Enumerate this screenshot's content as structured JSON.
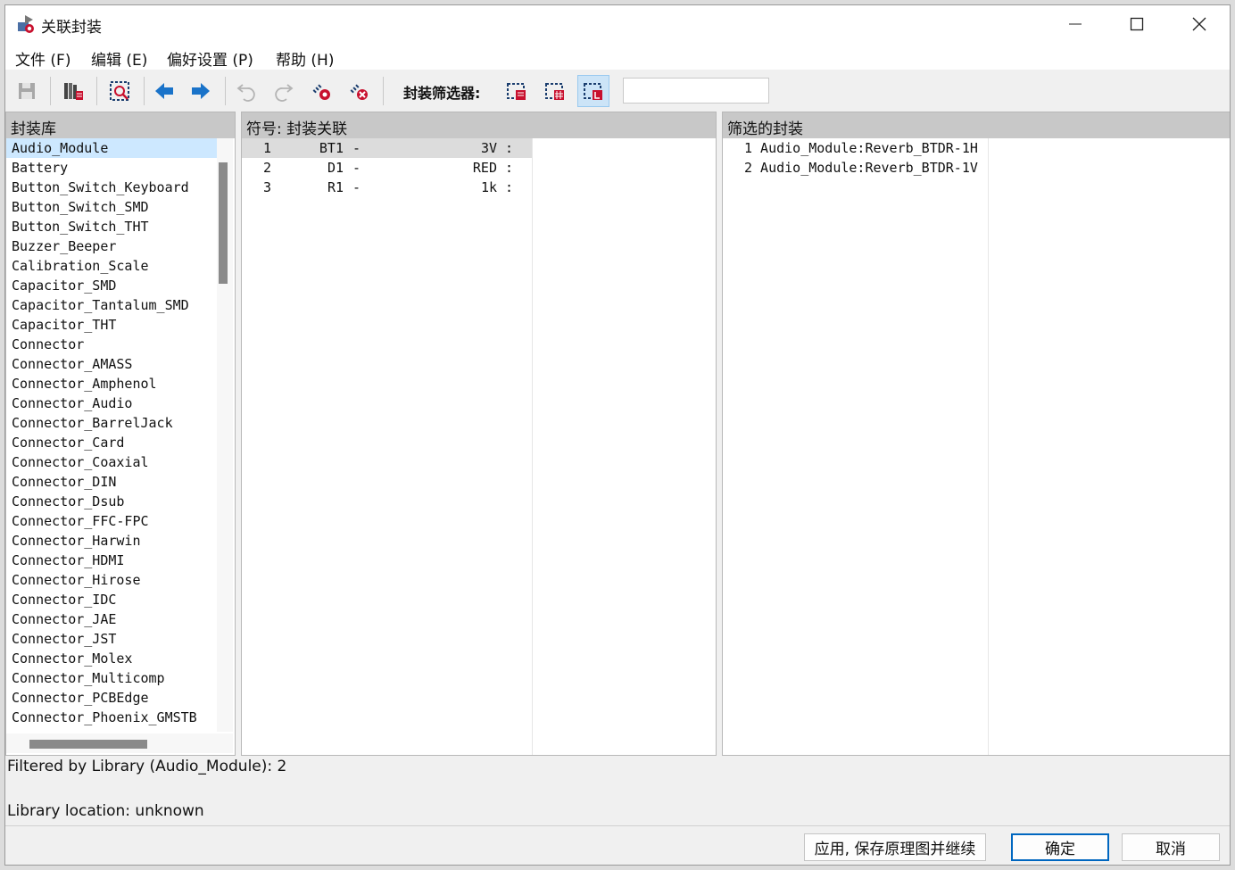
{
  "window": {
    "title": "关联封装"
  },
  "menu": [
    "文件 (F)",
    "编辑 (E)",
    "偏好设置 (P)",
    "帮助 (H)"
  ],
  "toolbar": {
    "filter_label": "封装筛选器:",
    "filter_input_value": ""
  },
  "left_panel": {
    "header": "封装库",
    "selected": "Audio_Module",
    "items": [
      "Audio_Module",
      "Battery",
      "Button_Switch_Keyboard",
      "Button_Switch_SMD",
      "Button_Switch_THT",
      "Buzzer_Beeper",
      "Calibration_Scale",
      "Capacitor_SMD",
      "Capacitor_Tantalum_SMD",
      "Capacitor_THT",
      "Connector",
      "Connector_AMASS",
      "Connector_Amphenol",
      "Connector_Audio",
      "Connector_BarrelJack",
      "Connector_Card",
      "Connector_Coaxial",
      "Connector_DIN",
      "Connector_Dsub",
      "Connector_FFC-FPC",
      "Connector_Harwin",
      "Connector_HDMI",
      "Connector_Hirose",
      "Connector_IDC",
      "Connector_JAE",
      "Connector_JST",
      "Connector_Molex",
      "Connector_Multicomp",
      "Connector_PCBEdge",
      "Connector_Phoenix_GMSTB"
    ]
  },
  "middle_panel": {
    "header": "符号: 封装关联",
    "rows": [
      {
        "num": "1",
        "ref": "BT1",
        "dash": "-",
        "value": "3V",
        "colon": ":"
      },
      {
        "num": "2",
        "ref": "D1",
        "dash": "-",
        "value": "RED",
        "colon": ":"
      },
      {
        "num": "3",
        "ref": "R1",
        "dash": "-",
        "value": "1k",
        "colon": ":"
      }
    ]
  },
  "right_panel": {
    "header": "筛选的封装",
    "items": [
      "1 Audio_Module:Reverb_BTDR-1H",
      "2 Audio_Module:Reverb_BTDR-1V"
    ]
  },
  "status": {
    "filtered": "Filtered by Library (Audio_Module): 2",
    "location": "Library location: unknown"
  },
  "buttons": {
    "apply": "应用, 保存原理图并继续",
    "ok": "确定",
    "cancel": "取消"
  },
  "colors": {
    "accent": "#0067c0",
    "arrow_blue": "#1a73c9",
    "icon_red": "#c8102e"
  }
}
